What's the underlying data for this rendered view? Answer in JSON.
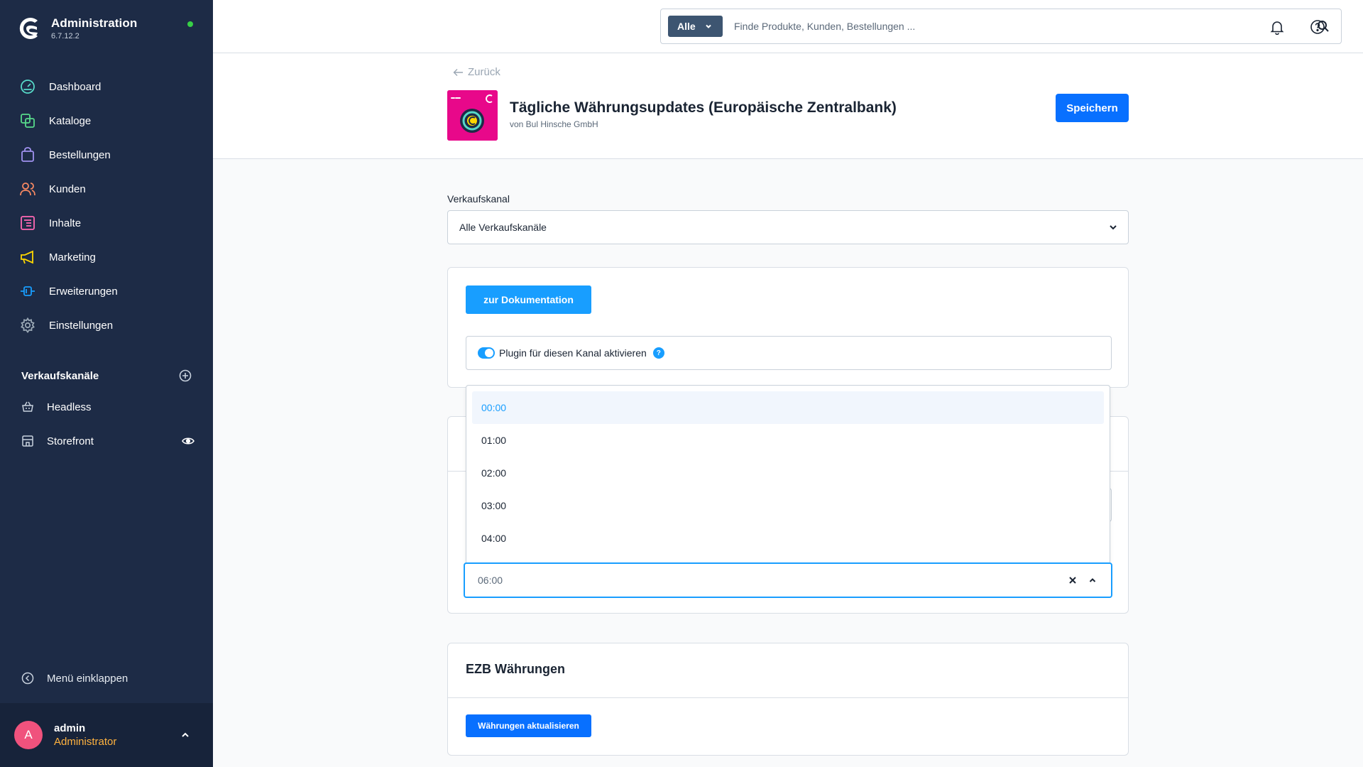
{
  "sidebar": {
    "brand_title": "Administration",
    "brand_version": "6.7.12.2",
    "items": [
      {
        "label": "Dashboard",
        "icon": "dashboard-icon",
        "color": "#57d9c8"
      },
      {
        "label": "Kataloge",
        "icon": "catalog-icon",
        "color": "#57d98a"
      },
      {
        "label": "Bestellungen",
        "icon": "bag-icon",
        "color": "#a092f0"
      },
      {
        "label": "Kunden",
        "icon": "users-icon",
        "color": "#f88962"
      },
      {
        "label": "Inhalte",
        "icon": "content-icon",
        "color": "#ff68b4"
      },
      {
        "label": "Marketing",
        "icon": "megaphone-icon",
        "color": "#ffd700"
      },
      {
        "label": "Erweiterungen",
        "icon": "plug-icon",
        "color": "#189eff"
      },
      {
        "label": "Einstellungen",
        "icon": "gear-icon",
        "color": "#9aa8b5"
      }
    ],
    "sales_channels_title": "Verkaufskanäle",
    "sales_channels": [
      {
        "label": "Headless",
        "icon": "basket-icon"
      },
      {
        "label": "Storefront",
        "icon": "store-icon"
      }
    ],
    "collapse_label": "Menü einklappen",
    "user": {
      "initial": "A",
      "name": "admin",
      "role": "Administrator"
    }
  },
  "topbar": {
    "search_scope": "Alle",
    "search_placeholder": "Finde Produkte, Kunden, Bestellungen ..."
  },
  "header": {
    "back_label": "Zurück",
    "title": "Tägliche Währungsupdates (Europäische Zentralbank)",
    "subtitle": "von Bul Hinsche GmbH",
    "save_label": "Speichern"
  },
  "content": {
    "sales_channel_label": "Verkaufskanal",
    "sales_channel_value": "Alle Verkaufskanäle",
    "doc_button": "zur Dokumentation",
    "toggle_label": "Plugin für diesen Kanal aktivieren",
    "help_mark": "?",
    "time_value": "06:00",
    "time_options": [
      "00:00",
      "01:00",
      "02:00",
      "03:00",
      "04:00"
    ],
    "ezb_title": "EZB Währungen",
    "ezb_button": "Währungen aktualisieren"
  },
  "colors": {
    "sidebar_bg": "#1d2b46",
    "primary": "#0870ff",
    "accent": "#189eff",
    "role": "#ffb23f",
    "avatar": "#f0527d"
  }
}
